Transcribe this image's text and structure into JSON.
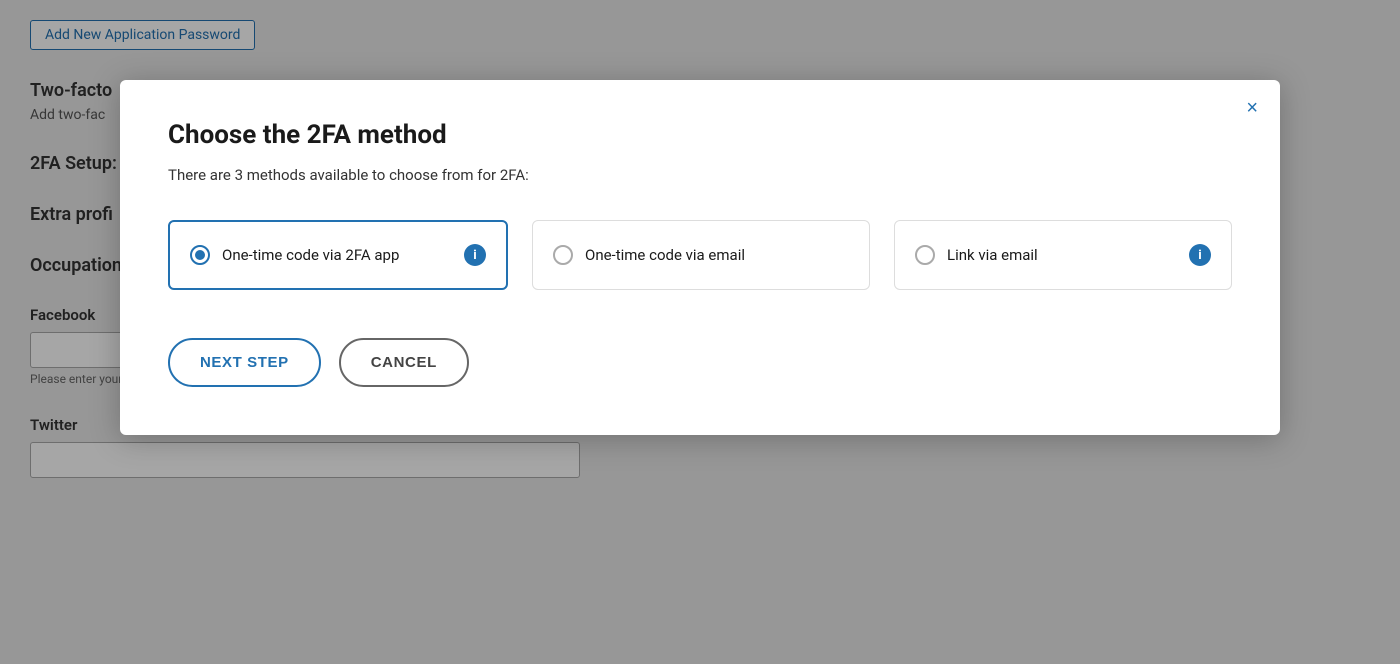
{
  "background": {
    "add_password_btn": "Add New Application Password",
    "sections": [
      {
        "id": "two-factor",
        "title": "Two-facto",
        "desc": "Add two-fac"
      },
      {
        "id": "2fa-setup",
        "title": "2FA Setup:"
      },
      {
        "id": "extra-profile",
        "title": "Extra profi"
      },
      {
        "id": "occupation",
        "title": "Occupation"
      },
      {
        "id": "facebook",
        "title": "Facebook",
        "hint": "Please enter your Facebook url. (be sure to include https://)"
      },
      {
        "id": "twitter",
        "title": "Twitter"
      }
    ]
  },
  "modal": {
    "title": "Choose the 2FA method",
    "subtitle": "There are 3 methods available to choose from for 2FA:",
    "close_label": "×",
    "options": [
      {
        "id": "app",
        "label": "One-time code via 2FA app",
        "selected": true,
        "has_info": true
      },
      {
        "id": "email-code",
        "label": "One-time code via email",
        "selected": false,
        "has_info": false
      },
      {
        "id": "email-link",
        "label": "Link via email",
        "selected": false,
        "has_info": true
      }
    ],
    "info_badge_label": "i",
    "buttons": {
      "next": "NEXT STEP",
      "cancel": "CANCEL"
    }
  }
}
